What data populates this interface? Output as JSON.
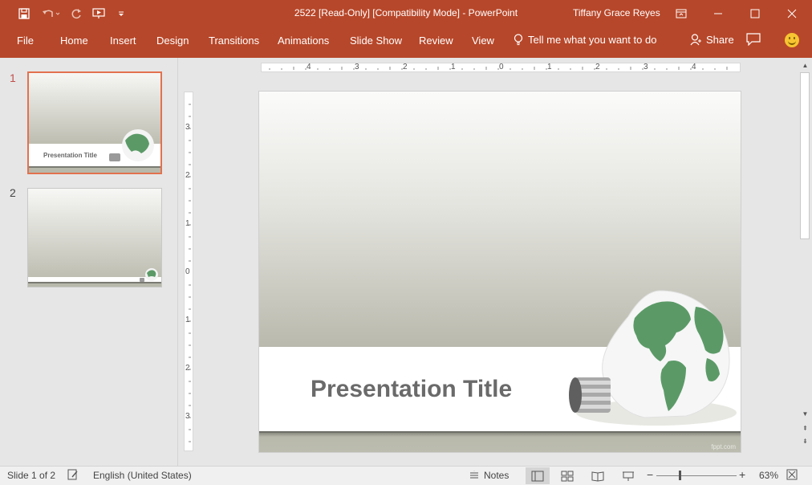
{
  "titlebar": {
    "title": "2522 [Read-Only] [Compatibility Mode]  -  PowerPoint",
    "user": "Tiffany Grace Reyes",
    "bg_color": "#b7472a"
  },
  "ribbon": {
    "tabs": [
      "File",
      "Home",
      "Insert",
      "Design",
      "Transitions",
      "Animations",
      "Slide Show",
      "Review",
      "View"
    ],
    "tell_me": "Tell me what you want to do",
    "share": "Share"
  },
  "thumbnails": {
    "slides": [
      {
        "number": "1",
        "title": "Presentation Title",
        "selected": true
      },
      {
        "number": "2",
        "title": "",
        "selected": false
      }
    ]
  },
  "rulers": {
    "horizontal": [
      "4",
      "3",
      "2",
      "1",
      "0",
      "1",
      "2",
      "3",
      "4"
    ],
    "vertical": [
      "3",
      "2",
      "1",
      "0",
      "1",
      "2",
      "3"
    ]
  },
  "slide": {
    "title": "Presentation Title",
    "footer_brand": "fppt.com"
  },
  "statusbar": {
    "slide_info": "Slide 1 of 2",
    "language": "English (United States)",
    "notes": "Notes",
    "zoom": "63%"
  },
  "colors": {
    "accent": "#b7472a",
    "thumb_selected": "#e2724f",
    "globe_green": "#5b9a67"
  }
}
